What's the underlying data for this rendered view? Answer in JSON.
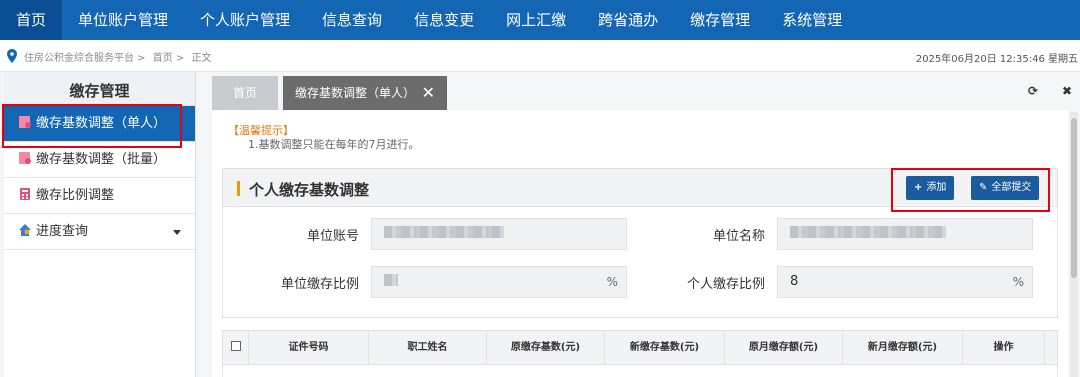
{
  "nav": {
    "items": [
      "首页",
      "单位账户管理",
      "个人账户管理",
      "信息查询",
      "信息变更",
      "网上汇缴",
      "跨省通办",
      "缴存管理",
      "系统管理"
    ]
  },
  "breadcrumb": {
    "items": [
      "住房公积金综合服务平台 >",
      "首页 >",
      "正文"
    ],
    "datetime": "2025年06月20日 12:35:46 星期五"
  },
  "sidebar": {
    "title": "缴存管理",
    "items": [
      "缴存基数调整（单人）",
      "缴存基数调整（批量）",
      "缴存比例调整",
      "进度查询"
    ]
  },
  "tabs": {
    "home": "首页",
    "current": "缴存基数调整（单人）",
    "close": "✕",
    "refresh": "⟳",
    "close_all": "✖"
  },
  "tip": {
    "title": "【温馨提示】",
    "line1": "1.基数调整只能在每年的7月进行。"
  },
  "card": {
    "title": "个人缴存基数调整",
    "add_label": "添加",
    "add_icon": "+",
    "submit_label": "全部提交",
    "submit_icon": "✎"
  },
  "form": {
    "unit_account_label": "单位账号",
    "unit_name_label": "单位名称",
    "unit_ratio_label": "单位缴存比例",
    "personal_ratio_label": "个人缴存比例",
    "personal_ratio_value": "8",
    "percent": "%"
  },
  "table": {
    "headers": [
      "证件号码",
      "职工姓名",
      "原缴存基数(元)",
      "新缴存基数(元)",
      "原月缴存额(元)",
      "新月缴存额(元)",
      "操作"
    ]
  },
  "colors": {
    "nav": "#1266b4",
    "highlight_box": "#e60012",
    "accent_bar": "#f39800",
    "button": "#1a5b9e"
  }
}
